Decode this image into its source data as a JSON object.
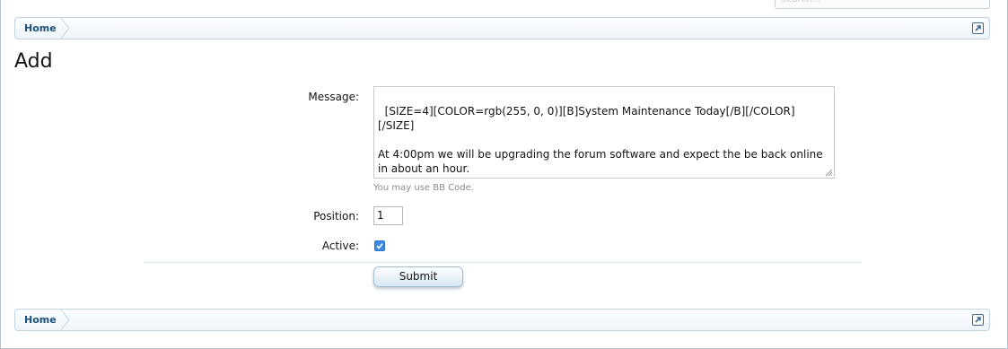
{
  "search": {
    "placeholder": "Search..."
  },
  "breadcrumb_top": {
    "home_label": "Home"
  },
  "breadcrumb_bottom": {
    "home_label": "Home"
  },
  "page": {
    "title": "Add"
  },
  "form": {
    "message_label": "Message:",
    "message_value": "[SIZE=4][COLOR=rgb(255, 0, 0)][B]System Maintenance Today[/B][/COLOR][/SIZE]\n\nAt 4:00pm we will be upgrading the forum software and expect the be back online in about an hour.",
    "message_hint": "You may use BB Code.",
    "position_label": "Position:",
    "position_value": "1",
    "active_label": "Active:",
    "active_checked": true,
    "submit_label": "Submit"
  },
  "colors": {
    "link": "#1b4f7c",
    "breadcrumb_border": "#c2d3e2",
    "checkbox": "#3d8be2"
  },
  "icons": {
    "jump": "jump-link-icon",
    "resize": "resize-handle-icon",
    "check": "check-icon"
  }
}
